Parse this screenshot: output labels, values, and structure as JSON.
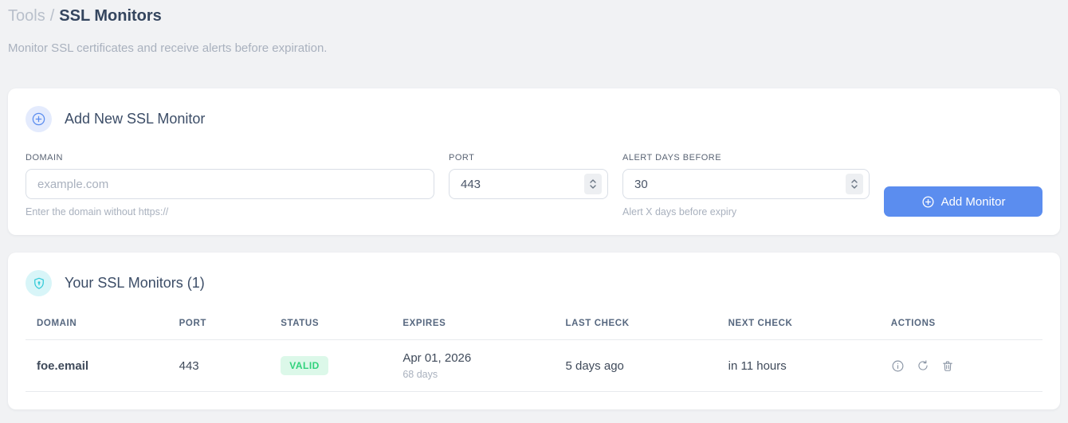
{
  "page": {
    "breadcrumb": {
      "parent": "Tools",
      "separator": "/",
      "current": "SSL Monitors"
    },
    "subtitle": "Monitor SSL certificates and receive alerts before expiration."
  },
  "add_monitor": {
    "title": "Add New SSL Monitor",
    "header_icon": "plus-circle-icon",
    "fields": {
      "domain": {
        "label": "DOMAIN",
        "placeholder": "example.com",
        "value": "",
        "help": "Enter the domain without https://"
      },
      "port": {
        "label": "PORT",
        "value": "443"
      },
      "alert_days": {
        "label": "ALERT DAYS BEFORE",
        "value": "30",
        "help": "Alert X days before expiry"
      }
    },
    "submit_label": "Add Monitor"
  },
  "monitors": {
    "title": "Your SSL Monitors (1)",
    "count": 1,
    "header_icon": "shield-icon",
    "table": {
      "headers": [
        "DOMAIN",
        "PORT",
        "STATUS",
        "EXPIRES",
        "LAST CHECK",
        "NEXT CHECK",
        "ACTIONS"
      ],
      "rows": [
        {
          "domain": "foe.email",
          "port": "443",
          "status": "VALID",
          "expires_date": "Apr 01, 2026",
          "expires_in": "68 days",
          "last_check": "5 days ago",
          "next_check": "in 11 hours",
          "actions": [
            "info-icon",
            "refresh-icon",
            "trash-icon"
          ]
        }
      ]
    }
  },
  "colors": {
    "accent_blue": "#5b8def",
    "valid_badge_bg": "#dcf8e9",
    "valid_badge_text": "#31d27c",
    "cyan_accent": "#2bc8d6",
    "page_background": "#f1f2f4"
  }
}
